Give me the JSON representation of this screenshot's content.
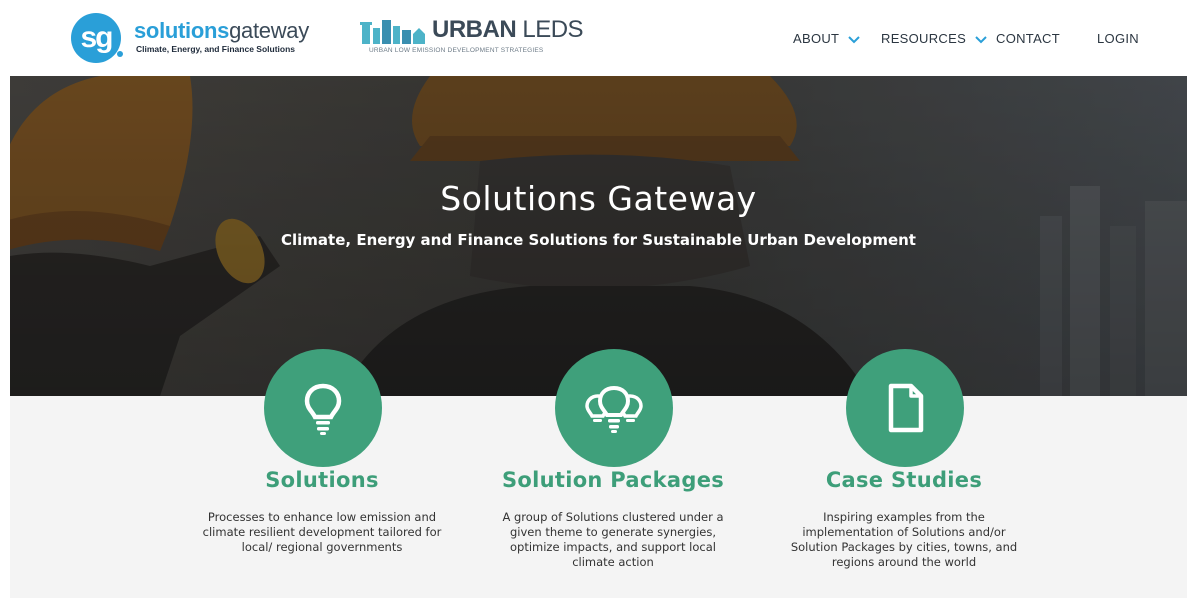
{
  "header": {
    "brand": {
      "name_bold": "solutions",
      "name_light": "gateway",
      "mark_text": "sg",
      "tagline": "Climate, Energy, and Finance Solutions"
    },
    "partner": {
      "name_bold": "URBAN",
      "name_light": " LEDS",
      "subtitle": "URBAN LOW EMISSION DEVELOPMENT STRATEGIES"
    },
    "nav": [
      {
        "label": "ABOUT",
        "icon": "chevron-down-icon"
      },
      {
        "label": "RESOURCES",
        "icon": "chevron-down-icon"
      },
      {
        "label": "CONTACT"
      },
      {
        "label": "LOGIN"
      }
    ]
  },
  "hero": {
    "title": "Solutions Gateway",
    "subtitle": "Climate, Energy and Finance Solutions for Sustainable Urban Development"
  },
  "features": [
    {
      "icon": "lightbulb-icon",
      "title": "Solutions",
      "description_lines": [
        "Processes to enhance low emission and",
        "climate resilient development tailored for",
        "local/ regional governments"
      ]
    },
    {
      "icon": "lightbulbs-icon",
      "title": "Solution Packages",
      "description_lines": [
        "A group of Solutions clustered under a",
        "given theme to generate synergies,",
        "optimize impacts, and support local",
        "climate action"
      ]
    },
    {
      "icon": "document-icon",
      "title": "Case Studies",
      "description_lines": [
        "Inspiring examples from the",
        "implementation of Solutions and/or",
        "Solution Packages by cities, towns, and",
        "regions around the world"
      ]
    }
  ],
  "colors": {
    "brand_blue": "#2a9fd8",
    "accent_green": "#3fa07b",
    "nav_chevron": "#2a9fd8",
    "urban_teal": "#4db3c8"
  }
}
